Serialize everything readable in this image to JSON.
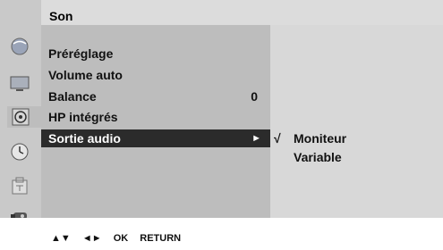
{
  "header": {
    "title": "Son"
  },
  "sidebar": {
    "icons": [
      {
        "name": "picture-globe-icon"
      },
      {
        "name": "screen-icon"
      },
      {
        "name": "speaker-icon"
      },
      {
        "name": "clock-icon"
      },
      {
        "name": "lock-icon"
      },
      {
        "name": "input-icon"
      }
    ],
    "active_index": 2
  },
  "menu": {
    "items": [
      {
        "label": "Préréglage"
      },
      {
        "label": "Volume auto"
      },
      {
        "label": "Balance",
        "value": "0"
      },
      {
        "label": "HP intégrés"
      },
      {
        "label": "Sortie audio",
        "arrow": "►",
        "selected": true
      }
    ]
  },
  "submenu": {
    "check": "√",
    "options": [
      {
        "label": "Moniteur",
        "checked": true
      },
      {
        "label": "Variable",
        "checked": false
      }
    ]
  },
  "footer": {
    "updown": "▲▼",
    "leftright": "◄►",
    "ok": "OK",
    "return": "RETURN"
  },
  "colors": {
    "selected_bg": "#2b2b2b",
    "panel": "#bdbdbd",
    "subpanel": "#d8d8d8"
  }
}
